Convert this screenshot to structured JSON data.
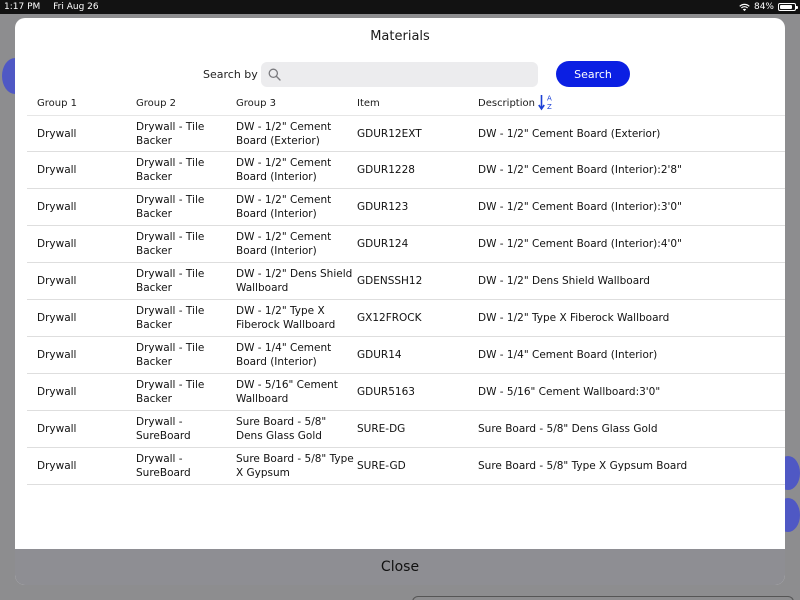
{
  "status_bar": {
    "time": "1:17 PM",
    "date": "Fri Aug 26",
    "battery": "84%",
    "battery_level": 0.84
  },
  "modal": {
    "title": "Materials",
    "search": {
      "label": "Search by",
      "value": "",
      "placeholder": "",
      "button_label": "Search"
    },
    "columns": [
      "Group 1",
      "Group 2",
      "Group 3",
      "Item",
      "Description"
    ],
    "sort": {
      "column": "Description",
      "direction": "A-Z"
    },
    "rows": [
      {
        "group1": "Drywall",
        "group2": "Drywall - Tile Backer",
        "group3": "DW - 1/2\" Cement Board (Exterior)",
        "item": "GDUR12EXT",
        "description": "DW - 1/2\" Cement Board (Exterior)"
      },
      {
        "group1": "Drywall",
        "group2": "Drywall - Tile Backer",
        "group3": "DW - 1/2\" Cement Board (Interior)",
        "item": "GDUR1228",
        "description": "DW - 1/2\" Cement Board (Interior):2'8\""
      },
      {
        "group1": "Drywall",
        "group2": "Drywall - Tile Backer",
        "group3": "DW - 1/2\" Cement Board (Interior)",
        "item": "GDUR123",
        "description": "DW - 1/2\" Cement Board (Interior):3'0\""
      },
      {
        "group1": "Drywall",
        "group2": "Drywall - Tile Backer",
        "group3": "DW - 1/2\" Cement Board (Interior)",
        "item": "GDUR124",
        "description": "DW - 1/2\" Cement Board (Interior):4'0\""
      },
      {
        "group1": "Drywall",
        "group2": "Drywall - Tile Backer",
        "group3": "DW - 1/2\" Dens Shield Wallboard",
        "item": "GDENSSH12",
        "description": "DW - 1/2\" Dens Shield Wallboard"
      },
      {
        "group1": "Drywall",
        "group2": "Drywall - Tile Backer",
        "group3": "DW - 1/2\" Type X Fiberock Wallboard",
        "item": "GX12FROCK",
        "description": "DW - 1/2\" Type X Fiberock Wallboard"
      },
      {
        "group1": "Drywall",
        "group2": "Drywall - Tile Backer",
        "group3": "DW - 1/4\" Cement Board (Interior)",
        "item": "GDUR14",
        "description": "DW - 1/4\" Cement Board (Interior)"
      },
      {
        "group1": "Drywall",
        "group2": "Drywall - Tile Backer",
        "group3": "DW - 5/16\" Cement Wallboard",
        "item": "GDUR5163",
        "description": "DW - 5/16\" Cement Wallboard:3'0\""
      },
      {
        "group1": "Drywall",
        "group2": "Drywall - SureBoard",
        "group3": "Sure Board - 5/8\" Dens Glass Gold",
        "item": "SURE-DG",
        "description": "Sure Board - 5/8\" Dens Glass Gold"
      },
      {
        "group1": "Drywall",
        "group2": "Drywall - SureBoard",
        "group3": "Sure Board - 5/8\" Type X Gypsum",
        "item": "SURE-GD",
        "description": "Sure Board - 5/8\" Type X Gypsum Board"
      }
    ],
    "close_label": "Close"
  },
  "icons": {
    "wifi": "wifi-icon",
    "battery": "battery-icon",
    "search": "search-icon",
    "sort": "sort-ascending-icon"
  },
  "colors": {
    "accent": "#0b1fe3",
    "overlay": "#8d8d8f",
    "close_bar": "#8e8e93",
    "sort_icon": "#1a3fd6"
  }
}
